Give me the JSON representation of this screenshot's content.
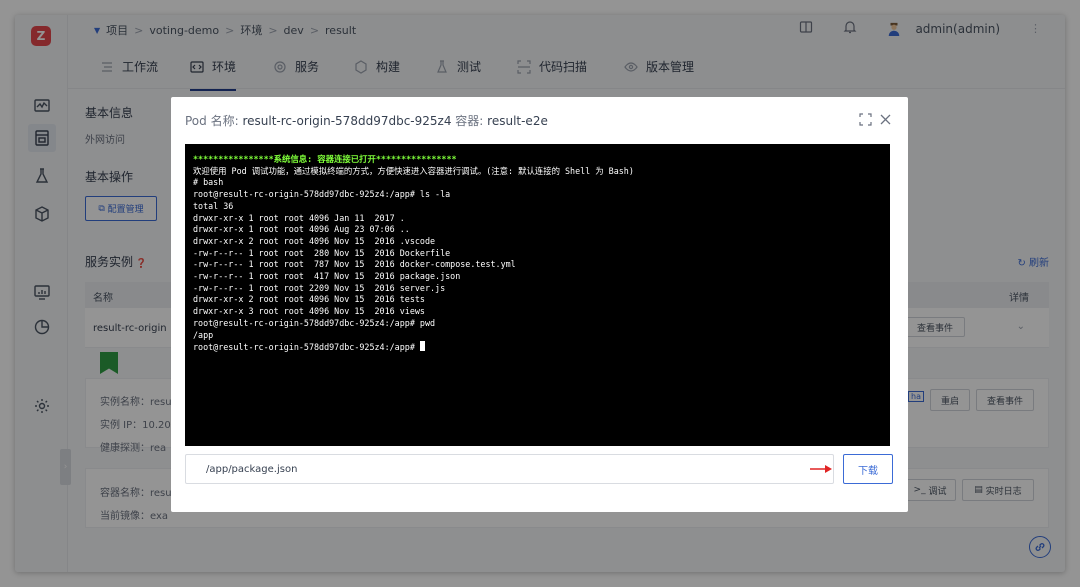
{
  "header": {
    "breadcrumb": [
      "项目",
      "voting-demo",
      "环境",
      "dev",
      "result"
    ],
    "user": "admin(admin)"
  },
  "tabs": [
    {
      "label": "工作流",
      "icon": "workflow-icon"
    },
    {
      "label": "环境",
      "icon": "code-icon"
    },
    {
      "label": "服务",
      "icon": "gear-icon"
    },
    {
      "label": "构建",
      "icon": "build-icon"
    },
    {
      "label": "测试",
      "icon": "flask-icon"
    },
    {
      "label": "代码扫描",
      "icon": "scan-icon"
    },
    {
      "label": "版本管理",
      "icon": "eye-icon"
    }
  ],
  "content": {
    "basic_info": "基本信息",
    "external_access": "外网访问",
    "basic_ops": "基本操作",
    "config_button": "配置管理",
    "service_instances": "服务实例",
    "refresh": "刷新",
    "col_name": "名称",
    "col_detail": "详情",
    "row_name": "result-rc-origin",
    "view_events": "查看事件",
    "instance_name_label": "实例名称：resu",
    "instance_ip_label": "实例 IP：10.20",
    "health_label": "健康探测：rea",
    "tag_text": "ha",
    "restart": "重启",
    "view_events_2": "查看事件",
    "container_name_label": "容器名称：resu",
    "current_image_label": "当前镜像：exa",
    "debug": "调试",
    "realtime_logs": "实时日志"
  },
  "modal": {
    "title_pod_label": "Pod 名称: ",
    "title_pod_value": "result-rc-origin-578dd97dbc-925z4",
    "title_container_label": " 容器: ",
    "title_container_value": "result-e2e",
    "terminal": {
      "sys_line": "****************系统信息: 容器连接已打开****************",
      "lines": [
        "欢迎使用 Pod 调试功能，通过模拟终端的方式，方便快速进入容器进行调试。(注意: 默认连接的 Shell 为 Bash)",
        "# bash",
        "root@result-rc-origin-578dd97dbc-925z4:/app# ls -la",
        "total 36",
        "drwxr-xr-x 1 root root 4096 Jan 11  2017 .",
        "drwxr-xr-x 1 root root 4096 Aug 23 07:06 ..",
        "drwxr-xr-x 2 root root 4096 Nov 15  2016 .vscode",
        "-rw-r--r-- 1 root root  280 Nov 15  2016 Dockerfile",
        "-rw-r--r-- 1 root root  787 Nov 15  2016 docker-compose.test.yml",
        "-rw-r--r-- 1 root root  417 Nov 15  2016 package.json",
        "-rw-r--r-- 1 root root 2209 Nov 15  2016 server.js",
        "drwxr-xr-x 2 root root 4096 Nov 15  2016 tests",
        "drwxr-xr-x 3 root root 4096 Nov 15  2016 views",
        "root@result-rc-origin-578dd97dbc-925z4:/app# pwd",
        "/app",
        "root@result-rc-origin-578dd97dbc-925z4:/app# "
      ]
    },
    "path_value": "/app/package.json",
    "download": "下载"
  },
  "colors": {
    "accent": "#3b6bd6",
    "terminal_bg": "#000000",
    "terminal_sys": "#7fff3a",
    "arrow": "#e02424",
    "logo": "#e5484d"
  }
}
